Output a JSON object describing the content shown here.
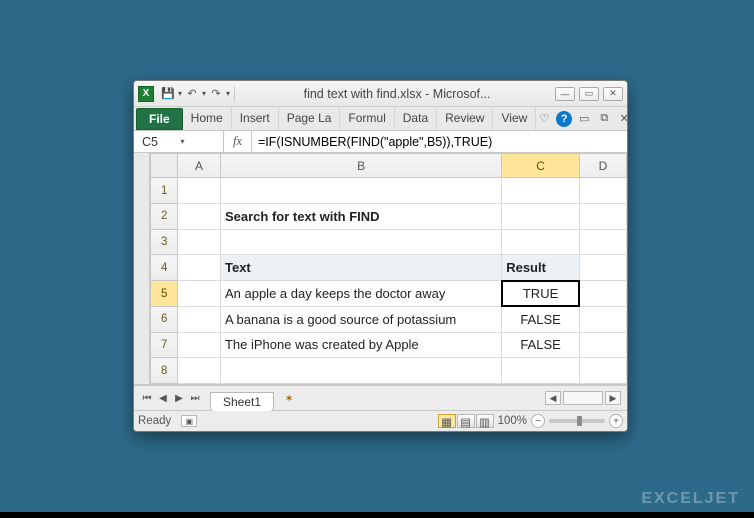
{
  "titlebar": {
    "title": "find text with find.xlsx  -  Microsof...",
    "qat": {
      "save": "💾"
    }
  },
  "ribbon": {
    "file": "File",
    "tabs": [
      "Home",
      "Insert",
      "Page La",
      "Formul",
      "Data",
      "Review",
      "View"
    ]
  },
  "formula_bar": {
    "cell_ref": "C5",
    "fx": "fx",
    "formula": "=IF(ISNUMBER(FIND(\"apple\",B5)),TRUE)"
  },
  "grid": {
    "columns": [
      "A",
      "B",
      "C",
      "D"
    ],
    "title": "Search for text with FIND",
    "headers": {
      "text": "Text",
      "result": "Result"
    },
    "rows": [
      {
        "text": "An apple a day keeps the doctor away",
        "result": "TRUE"
      },
      {
        "text": "A banana is a good source of potassium",
        "result": "FALSE"
      },
      {
        "text": "The iPhone was created by Apple",
        "result": "FALSE"
      }
    ]
  },
  "sheets": {
    "active": "Sheet1"
  },
  "status": {
    "ready": "Ready",
    "zoom": "100%"
  },
  "watermark": "EXCELJET"
}
